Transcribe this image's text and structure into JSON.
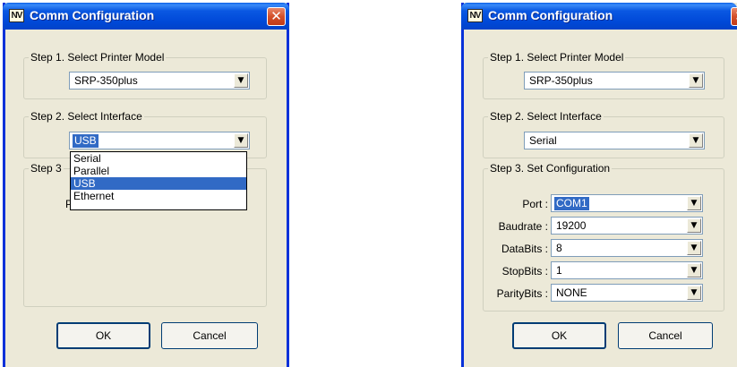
{
  "left_dialog": {
    "title": "Comm Configuration",
    "app_icon": "NV",
    "close_glyph": "✕",
    "step1": {
      "legend": "Step 1. Select Printer Model",
      "value": "SRP-350plus"
    },
    "step2": {
      "legend": "Step 2. Select Interface",
      "value": "USB"
    },
    "step3": {
      "legend_fragment": "Step 3",
      "hidden_char": "P"
    },
    "dropdown_options": [
      "Serial",
      "Parallel",
      "USB",
      "Ethernet"
    ],
    "highlighted_option": "USB",
    "ok_label": "OK",
    "cancel_label": "Cancel"
  },
  "right_dialog": {
    "title": "Comm Configuration",
    "app_icon": "NV",
    "close_glyph": "✕",
    "step1": {
      "legend": "Step 1. Select Printer Model",
      "value": "SRP-350plus"
    },
    "step2": {
      "legend": "Step 2. Select Interface",
      "value": "Serial"
    },
    "step3": {
      "legend": "Step 3. Set Configuration",
      "rows": [
        {
          "label": "Port :",
          "value": "COM1"
        },
        {
          "label": "Baudrate :",
          "value": "19200"
        },
        {
          "label": "DataBits :",
          "value": "8"
        },
        {
          "label": "StopBits :",
          "value": "1"
        },
        {
          "label": "ParityBits :",
          "value": "NONE"
        }
      ]
    },
    "ok_label": "OK",
    "cancel_label": "Cancel"
  },
  "icons": {
    "dropdown_arrow": "▼"
  },
  "colors": {
    "title_bar": "#0a58e2",
    "selection": "#316ac5",
    "close_button": "#d4502a",
    "dialog_bg": "#ece9d8"
  }
}
